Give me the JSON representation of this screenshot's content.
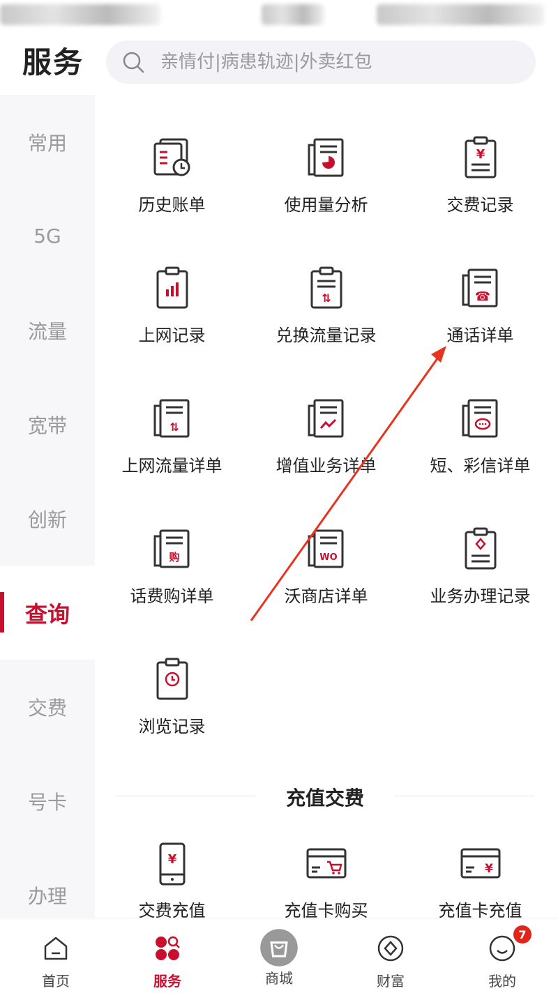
{
  "header": {
    "title": "服务",
    "search_placeholder": "亲情付|病患轨迹|外卖红包"
  },
  "sidebar": {
    "items": [
      {
        "label": "常用",
        "active": false
      },
      {
        "label": "5G",
        "active": false
      },
      {
        "label": "流量",
        "active": false
      },
      {
        "label": "宽带",
        "active": false
      },
      {
        "label": "创新",
        "active": false
      },
      {
        "label": "查询",
        "active": true
      },
      {
        "label": "交费",
        "active": false
      },
      {
        "label": "号卡",
        "active": false
      },
      {
        "label": "办理",
        "active": false
      }
    ]
  },
  "query_section": {
    "items": [
      {
        "label": "历史账单",
        "icon": "history-bill-icon"
      },
      {
        "label": "使用量分析",
        "icon": "usage-analysis-icon"
      },
      {
        "label": "交费记录",
        "icon": "payment-record-icon"
      },
      {
        "label": "上网记录",
        "icon": "internet-record-icon"
      },
      {
        "label": "兑换流量记录",
        "icon": "exchange-data-icon"
      },
      {
        "label": "通话详单",
        "icon": "call-detail-icon"
      },
      {
        "label": "上网流量详单",
        "icon": "data-detail-icon"
      },
      {
        "label": "增值业务详单",
        "icon": "value-added-icon"
      },
      {
        "label": "短、彩信详单",
        "icon": "sms-detail-icon"
      },
      {
        "label": "话费购详单",
        "icon": "purchase-detail-icon"
      },
      {
        "label": "沃商店详单",
        "icon": "wo-store-icon"
      },
      {
        "label": "业务办理记录",
        "icon": "business-record-icon"
      },
      {
        "label": "浏览记录",
        "icon": "browse-record-icon"
      }
    ]
  },
  "recharge_section": {
    "title": "充值交费",
    "items": [
      {
        "label": "交费充值",
        "icon": "phone-payment-icon"
      },
      {
        "label": "充值卡购买",
        "icon": "card-purchase-icon"
      },
      {
        "label": "充值卡充值",
        "icon": "card-recharge-icon"
      }
    ]
  },
  "tabbar": {
    "items": [
      {
        "label": "首页",
        "icon": "home-icon",
        "active": false
      },
      {
        "label": "服务",
        "icon": "services-icon",
        "active": true
      },
      {
        "label": "商城",
        "icon": "shop-icon",
        "active": false
      },
      {
        "label": "财富",
        "icon": "wealth-icon",
        "active": false
      },
      {
        "label": "我的",
        "icon": "profile-icon",
        "active": false,
        "badge": "7"
      }
    ]
  },
  "colors": {
    "accent": "#c8102e",
    "icon_stroke": "#333333",
    "arrow": "#e8331f"
  }
}
